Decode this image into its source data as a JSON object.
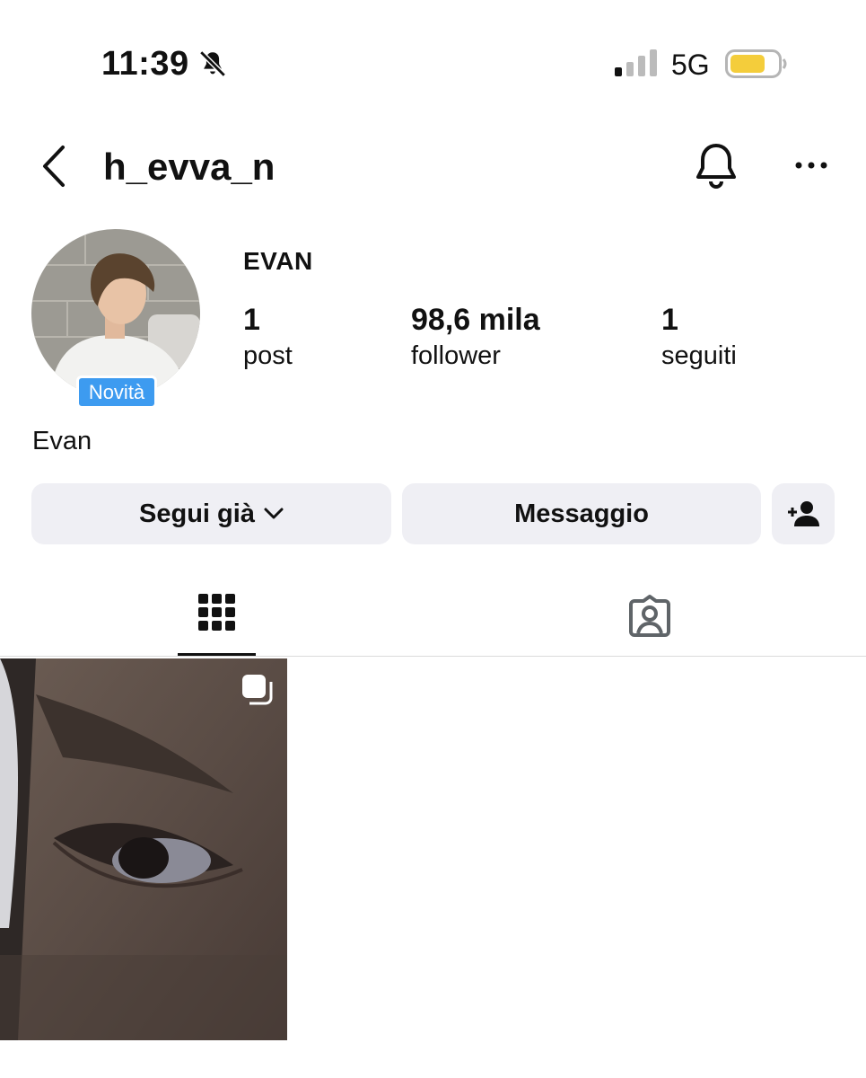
{
  "status_bar": {
    "time": "11:39",
    "network": "5G",
    "icons": [
      "bell-slash-icon",
      "signal-icon",
      "battery-icon"
    ],
    "battery_color": "#f4cd3b"
  },
  "header": {
    "username": "h_evva_n",
    "icons": [
      "chevron-left-icon",
      "bell-icon",
      "ellipsis-icon"
    ]
  },
  "profile": {
    "display_name": "EVAN",
    "badge": "Novità",
    "bio": "Evan",
    "stats": {
      "posts": {
        "value": "1",
        "label": "post"
      },
      "followers": {
        "value": "98,6 mila",
        "label": "follower"
      },
      "following": {
        "value": "1",
        "label": "seguiti"
      }
    }
  },
  "actions": {
    "follow_label": "Segui già",
    "message_label": "Messaggio",
    "add_icon": "add-person-icon"
  },
  "tabs": {
    "active": "grid",
    "items": [
      "grid-icon",
      "tagged-person-icon"
    ]
  },
  "colors": {
    "badge_blue": "#3d9bf0",
    "button_bg": "#efeff4"
  }
}
